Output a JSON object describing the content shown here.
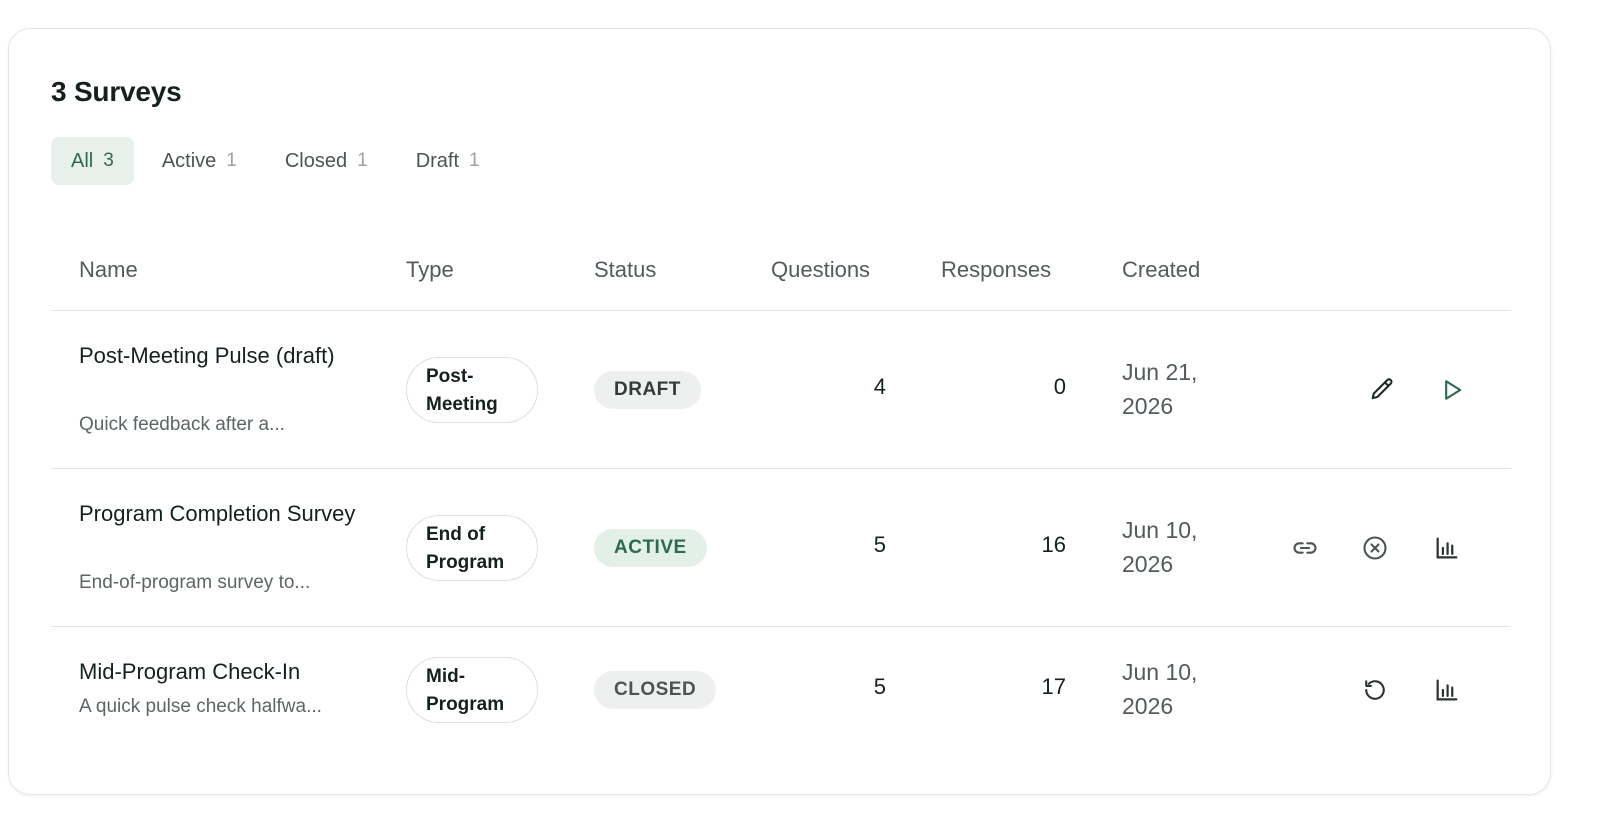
{
  "page": {
    "title": "3 Surveys"
  },
  "tabs": [
    {
      "label": "All",
      "count": "3"
    },
    {
      "label": "Active",
      "count": "1"
    },
    {
      "label": "Closed",
      "count": "1"
    },
    {
      "label": "Draft",
      "count": "1"
    }
  ],
  "columns": {
    "name": "Name",
    "type": "Type",
    "status": "Status",
    "questions": "Questions",
    "responses": "Responses",
    "created": "Created"
  },
  "rows": [
    {
      "name": "Post-Meeting Pulse (draft)",
      "description": "Quick feedback after a...",
      "type_line1": "Post-",
      "type_line2": "Meeting",
      "status": "DRAFT",
      "questions": "4",
      "responses": "0",
      "created_line1": "Jun 21,",
      "created_line2": "2026",
      "actions": [
        "pencil-icon",
        "play-icon"
      ]
    },
    {
      "name": "Program Completion Survey",
      "description": "End-of-program survey to...",
      "type_line1": "End of",
      "type_line2": "Program",
      "status": "ACTIVE",
      "questions": "5",
      "responses": "16",
      "created_line1": "Jun 10,",
      "created_line2": "2026",
      "actions": [
        "link-icon",
        "close-circle-icon",
        "bar-chart-icon"
      ]
    },
    {
      "name": "Mid-Program Check-In",
      "description": "A quick pulse check halfwa...",
      "type_line1": "Mid-",
      "type_line2": "Program",
      "status": "CLOSED",
      "questions": "5",
      "responses": "17",
      "created_line1": "Jun 10,",
      "created_line2": "2026",
      "actions": [
        "reopen-icon",
        "bar-chart-icon"
      ]
    }
  ],
  "colors": {
    "accent": "#2d6a4f",
    "border": "#e2e5e3",
    "text": "#15211b"
  }
}
